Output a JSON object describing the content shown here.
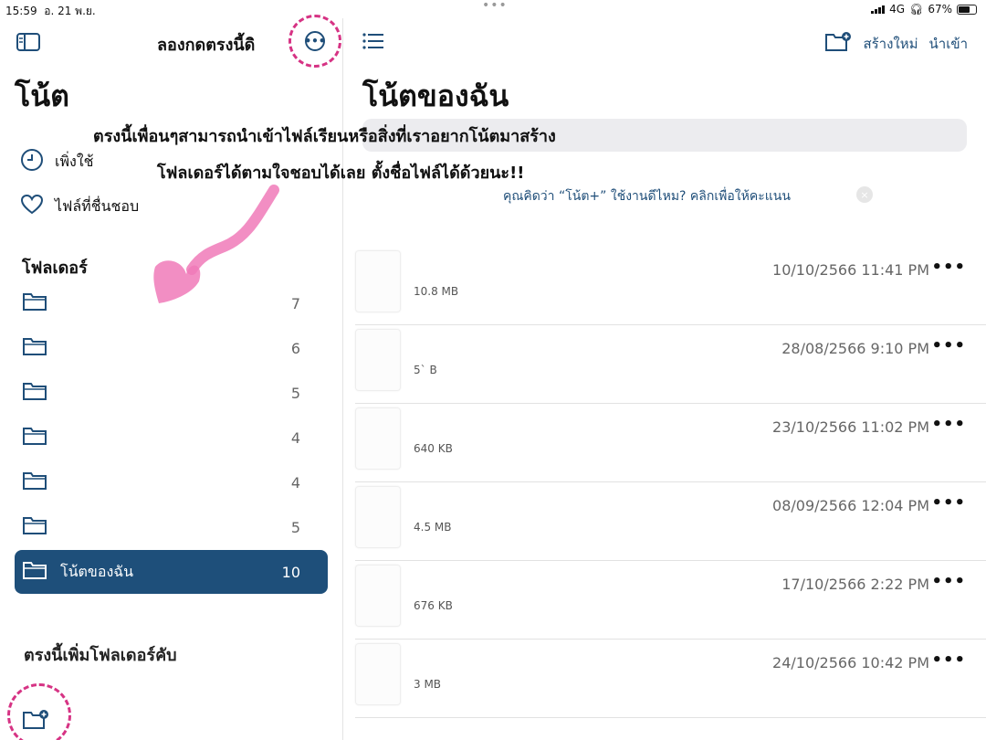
{
  "status_bar": {
    "time": "15:59",
    "date": "อ. 21 พ.ย.",
    "network": "4G",
    "battery": "67%",
    "battery_level": 0.67,
    "multitask_dots": "•••"
  },
  "sidebar": {
    "top_title": "ลองกดตรงนี้ดิ",
    "more_glyph": "•••",
    "title": "โน้ต",
    "nav": [
      {
        "label": "เพิ่งใช้",
        "icon": "clock-icon"
      },
      {
        "label": "ไฟล์ที่ชื่นชอบ",
        "icon": "heart-icon"
      }
    ],
    "folders_heading": "โฟลเดอร์",
    "folders": [
      {
        "name": "",
        "count": "7"
      },
      {
        "name": "",
        "count": "6"
      },
      {
        "name": "",
        "count": "5"
      },
      {
        "name": "",
        "count": "4"
      },
      {
        "name": "",
        "count": "4"
      },
      {
        "name": "",
        "count": "5"
      },
      {
        "name": "โน้ตของฉัน",
        "count": "10",
        "selected": true
      }
    ],
    "bottom_note": "ตรงนี้เพิ่มโฟลเดอร์คับ"
  },
  "main": {
    "create_label": "สร้างใหม่",
    "import_label": "นำเข้า",
    "title": "โน้ตของฉัน",
    "feedback": "คุณคิดว่า “โน้ต+” ใช้งานดีไหม? คลิกเพื่อให้คะแนน",
    "close_glyph": "×",
    "more_glyph": "•••",
    "files": [
      {
        "size": "10.8 MB",
        "date": "10/10/2566 11:41 PM"
      },
      {
        "size": "5` B",
        "date": "28/08/2566 9:10 PM"
      },
      {
        "size": "640 KB",
        "date": "23/10/2566 11:02 PM"
      },
      {
        "size": "4.5 MB",
        "date": "08/09/2566 12:04 PM"
      },
      {
        "size": "676 KB",
        "date": "17/10/2566 2:22 PM"
      },
      {
        "size": "3 MB",
        "date": "24/10/2566 10:42 PM"
      }
    ]
  },
  "annotations": {
    "line1": "ตรงนี้เพื่อนๆสามารถนำเข้าไฟล์เรียนหรือสิ่งที่เราอยากโน้ตมาสร้าง",
    "line2": "โฟลเดอร์ได้ตามใจชอบได้เลย ตั้งชื่อไฟล์ได้ด้วยนะ!!"
  },
  "colors": {
    "accent": "#1e4f7a",
    "highlight_ring": "#d63384",
    "arrow": "#f07ab8"
  }
}
